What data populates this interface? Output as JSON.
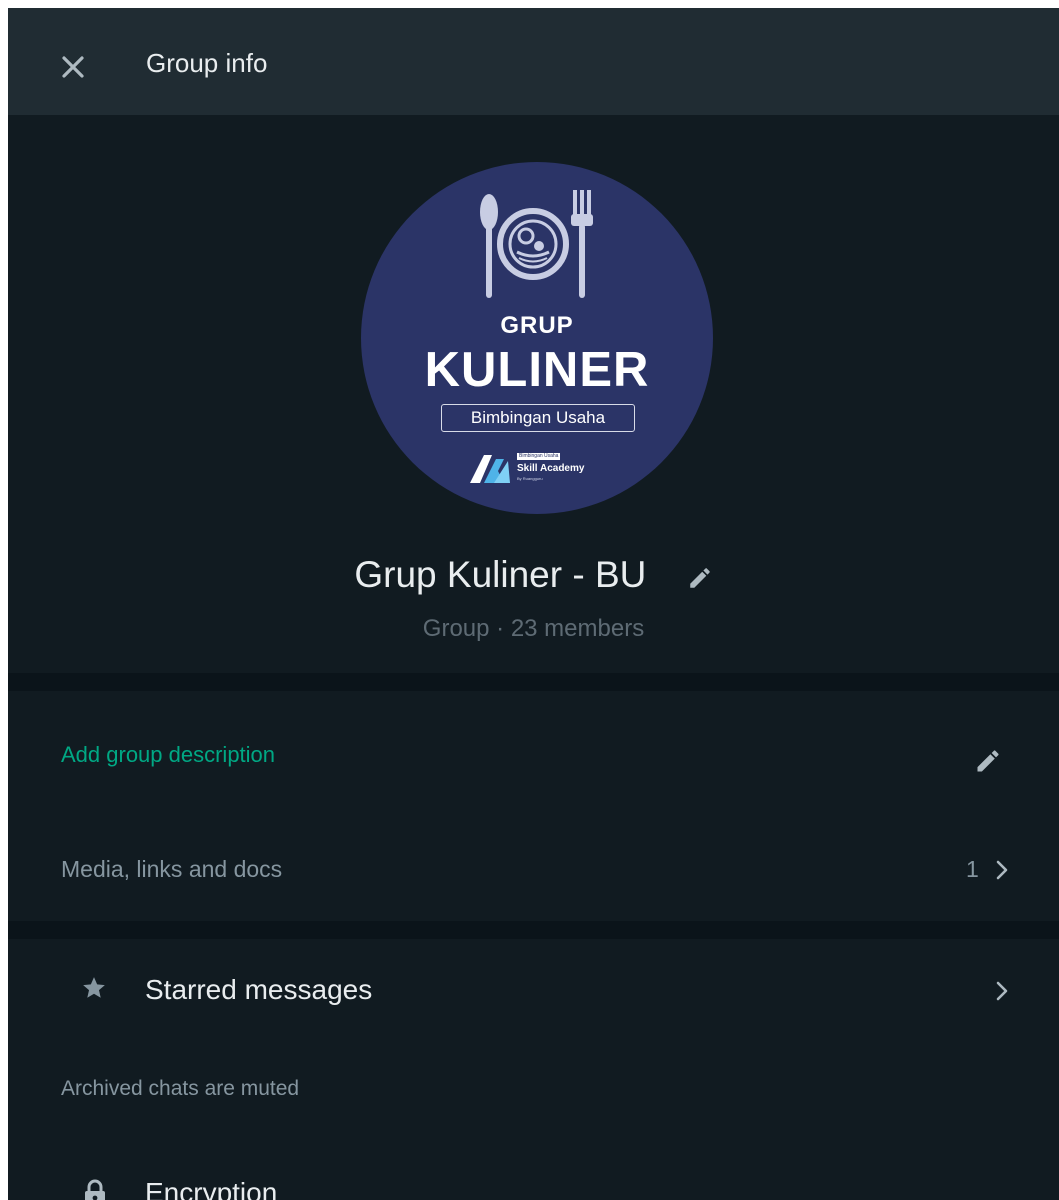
{
  "header": {
    "title": "Group info",
    "close_icon": "close-icon"
  },
  "profile": {
    "avatar": {
      "line1": "GRUP",
      "line2": "KULINER",
      "subtitle": "Bimbingan Usaha",
      "brand_small": "Bimbingan Usaha",
      "brand": "Skill Academy",
      "brand_by": "By Ruangguru"
    },
    "name": "Grup Kuliner - BU",
    "meta": "Group · 23 members"
  },
  "description": {
    "link": "Add group description"
  },
  "media": {
    "label": "Media, links and docs",
    "count": "1"
  },
  "starred": {
    "label": "Starred messages"
  },
  "archived": {
    "text": "Archived chats are muted"
  },
  "encryption": {
    "label": "Encryption"
  },
  "colors": {
    "panel_bg": "#111b21",
    "header_bg": "#202c33",
    "accent": "#00a884",
    "avatar_bg": "#2b3467",
    "primary_text": "#e9edef",
    "secondary_text": "#8696a0"
  }
}
